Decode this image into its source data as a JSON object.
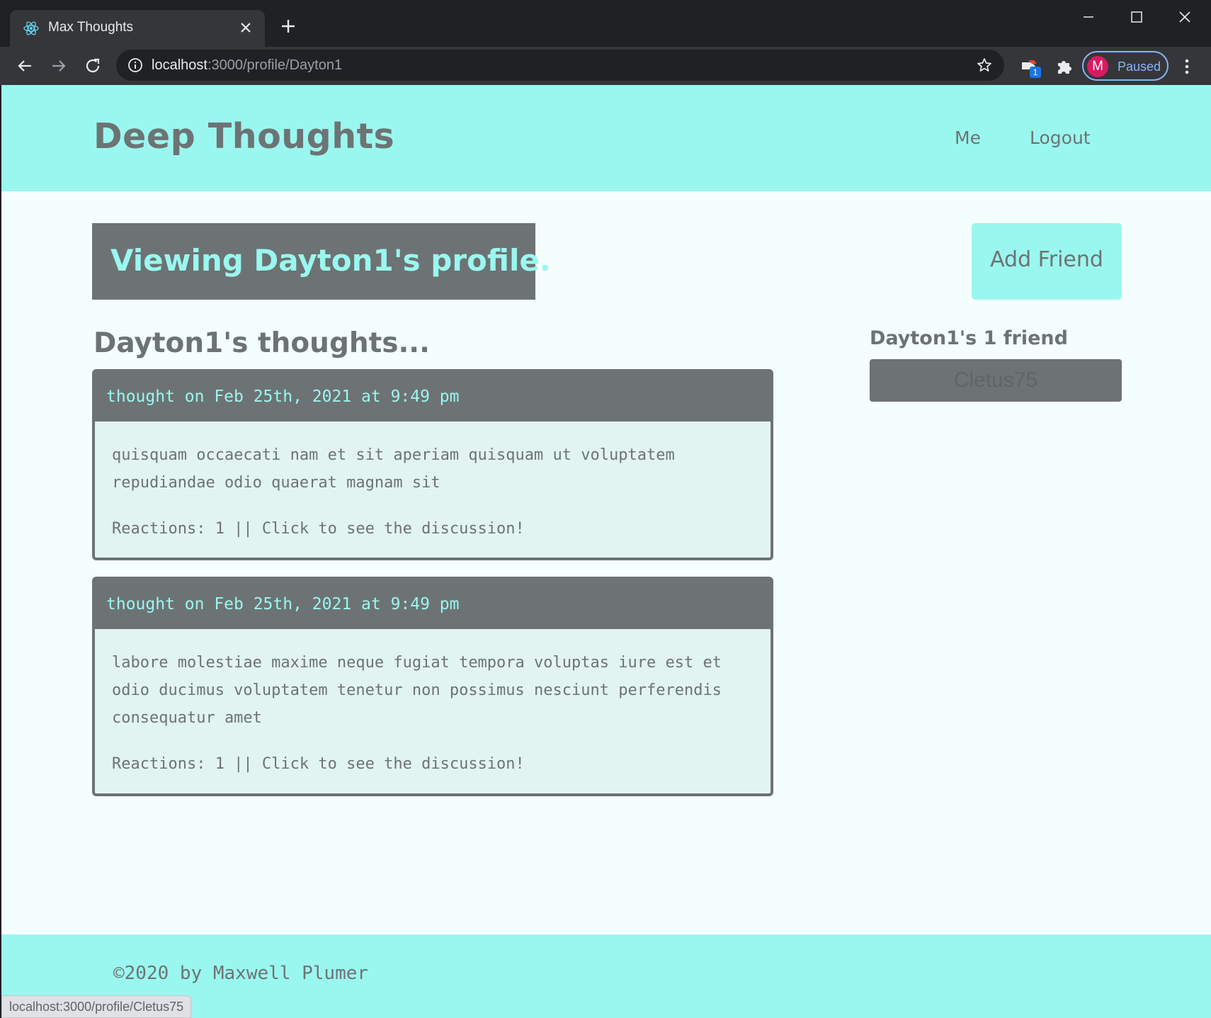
{
  "browser": {
    "tab": {
      "title": "Max Thoughts",
      "favicon": "react-icon"
    },
    "url_host": "localhost",
    "url_path": ":3000/profile/Dayton1",
    "extension_badge": "1",
    "profile": {
      "initial": "M",
      "label": "Paused",
      "avatar_color": "#d81b60"
    },
    "status_url": "localhost:3000/profile/Cletus75"
  },
  "header": {
    "title": "Deep Thoughts",
    "nav": [
      "Me",
      "Logout"
    ]
  },
  "profile": {
    "banner": "Viewing Dayton1's profile.",
    "add_friend_label": "Add Friend",
    "thoughts_heading": "Dayton1's thoughts...",
    "friends_heading": "Dayton1's 1 friend",
    "friends": [
      "Cletus75"
    ]
  },
  "thoughts": [
    {
      "header": "thought on Feb 25th, 2021 at 9:49 pm",
      "text": "quisquam occaecati nam et sit aperiam quisquam ut voluptatem repudiandae odio quaerat magnam sit",
      "reactions": "Reactions: 1 || Click to see the discussion!"
    },
    {
      "header": "thought on Feb 25th, 2021 at 9:49 pm",
      "text": "labore molestiae maxime neque fugiat tempora voluptas iure est et odio ducimus voluptatem tenetur non possimus nesciunt perferendis consequatur amet",
      "reactions": "Reactions: 1 || Click to see the discussion!"
    }
  ],
  "footer": {
    "text": "©2020 by Maxwell Plumer"
  },
  "colors": {
    "primary": "#9af7ef",
    "dark": "#6d7374",
    "background": "#f4fffd",
    "card": "#e2f4f2"
  }
}
